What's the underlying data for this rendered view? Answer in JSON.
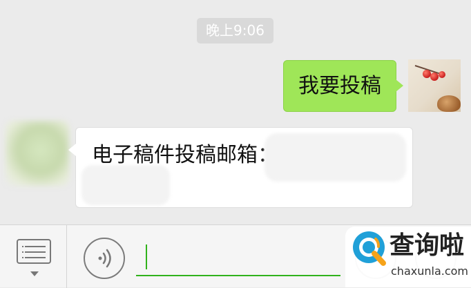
{
  "chat": {
    "timestamp": "晚上9:06",
    "messages": [
      {
        "direction": "outgoing",
        "text": "我要投稿"
      },
      {
        "direction": "incoming",
        "text": "电子稿件投稿邮箱："
      }
    ]
  },
  "input_bar": {
    "menu_icon": "menu-list-icon",
    "voice_icon": "voice-icon",
    "text_value": ""
  },
  "watermark": {
    "name": "查询啦",
    "url": "chaxunla.com"
  },
  "colors": {
    "outgoing_bubble": "#9fe658",
    "incoming_bubble": "#ffffff",
    "accent": "#30b21b",
    "chat_background": "#ebebeb"
  }
}
